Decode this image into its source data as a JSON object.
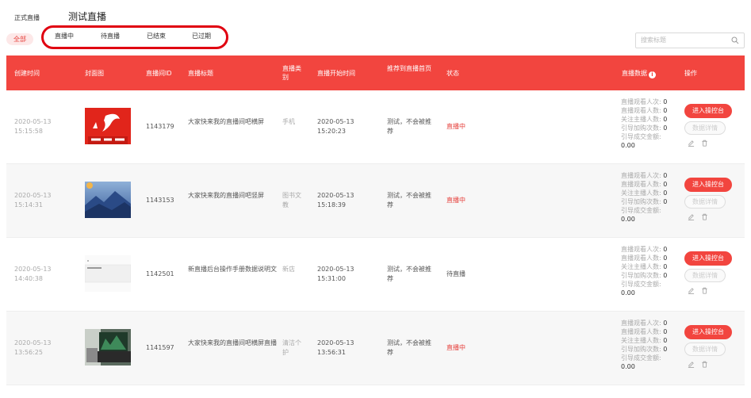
{
  "top_tabs": {
    "official": "正式直播",
    "test": "测试直播"
  },
  "filters": {
    "all": "全部",
    "items": [
      "直播中",
      "待直播",
      "已结束",
      "已过期"
    ]
  },
  "search": {
    "placeholder": "搜索标题"
  },
  "colors": {
    "accent": "#f2453f",
    "live_text": "#e6413c",
    "highlight_ring": "#e00010"
  },
  "table": {
    "headers": {
      "created": "创建时间",
      "cover": "封面图",
      "room_id": "直播间ID",
      "title": "直播标题",
      "category": "直播类别",
      "start": "直播开始时间",
      "recommend": "推荐到直播首页",
      "status": "状态",
      "data": "直播数据",
      "actions": "操作"
    },
    "stat_labels": [
      "直播观看人次:",
      "直播观看人数:",
      "关注主播人数:",
      "引导加购次数:",
      "引导成交金额:"
    ],
    "actions": {
      "enter": "进入操控台",
      "detail": "数据详情"
    },
    "rows": [
      {
        "created_date": "2020-05-13",
        "created_time": "15:15:58",
        "room_id": "1143179",
        "title": "大家快来我的直播间吧横屏",
        "category": "手机",
        "start_date": "2020-05-13",
        "start_time": "15:20:23",
        "recommend": "测试，不会被推荐",
        "status": "直播中",
        "stats": [
          "0",
          "0",
          "0",
          "0",
          "0.00"
        ],
        "cover": "jd-logo"
      },
      {
        "created_date": "2020-05-13",
        "created_time": "15:14:31",
        "room_id": "1143153",
        "title": "大家快来我的直播间吧竖屏",
        "category": "图书文教",
        "start_date": "2020-05-13",
        "start_time": "15:18:39",
        "recommend": "测试，不会被推荐",
        "status": "直播中",
        "stats": [
          "0",
          "0",
          "0",
          "0",
          "0.00"
        ],
        "cover": "mountain-photo"
      },
      {
        "created_date": "2020-05-13",
        "created_time": "14:40:38",
        "room_id": "1142501",
        "title": "新直播后台操作手册数据说明文",
        "category": "新店",
        "start_date": "2020-05-13",
        "start_time": "15:31:00",
        "recommend": "测试，不会被推荐",
        "status": "待直播",
        "stats": [
          "0",
          "0",
          "0",
          "0",
          "0.00"
        ],
        "cover": "document-screenshot"
      },
      {
        "created_date": "2020-05-13",
        "created_time": "13:56:25",
        "room_id": "1141597",
        "title": "大家快来我的直播间吧横屏直播",
        "category": "清洁个护",
        "start_date": "2020-05-13",
        "start_time": "13:56:31",
        "recommend": "测试，不会被推荐",
        "status": "直播中",
        "stats": [
          "0",
          "0",
          "0",
          "0",
          "0.00"
        ],
        "cover": "laptop-photo"
      }
    ]
  }
}
